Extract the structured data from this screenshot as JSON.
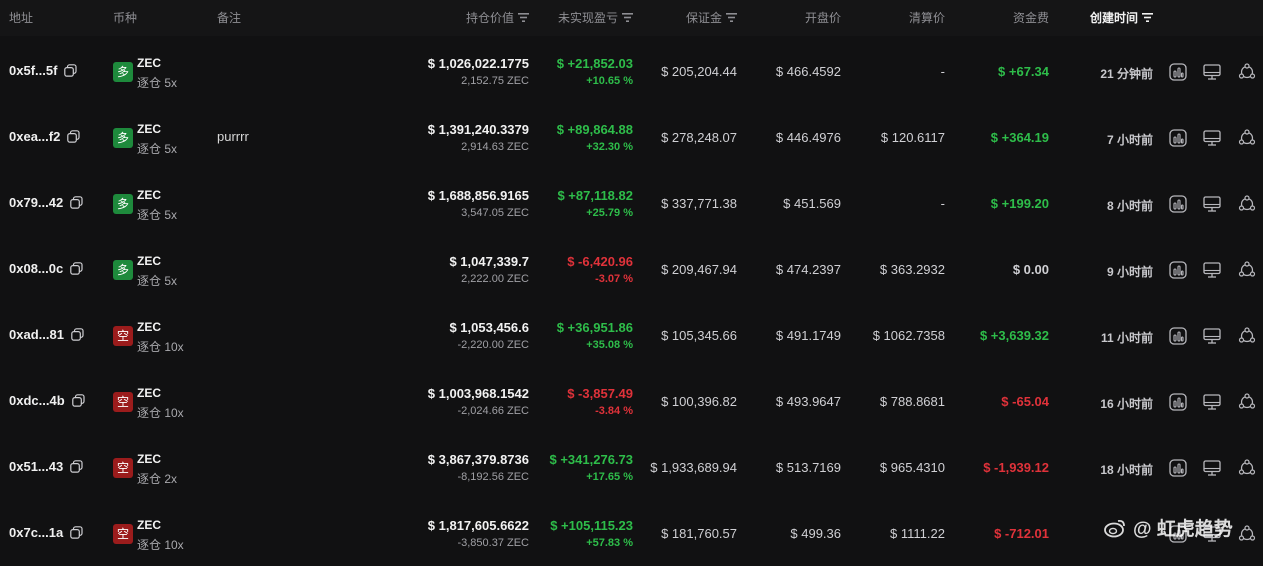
{
  "header": {
    "address": "地址",
    "coin": "币种",
    "note": "备注",
    "value": "持仓价值",
    "pnl": "未实现盈亏",
    "margin": "保证金",
    "open_price": "开盘价",
    "liq_price": "清算价",
    "funding": "资金费",
    "created": "创建时间"
  },
  "rows": [
    {
      "address": "0x5f...5f",
      "side": "多",
      "side_type": "long",
      "coin": "ZEC",
      "mode": "逐仓 5x",
      "note": "",
      "value": "$ 1,026,022.1775",
      "size": "2,152.75 ZEC",
      "pnl": "$ +21,852.03",
      "pnl_pct": "+10.65 %",
      "pnl_sign": "pos",
      "margin": "$ 205,204.44",
      "open": "$ 466.4592",
      "liq": "-",
      "funding": "$ +67.34",
      "funding_sign": "pos",
      "time": "21 分钟前"
    },
    {
      "address": "0xea...f2",
      "side": "多",
      "side_type": "long",
      "coin": "ZEC",
      "mode": "逐仓 5x",
      "note": "purrrr",
      "value": "$ 1,391,240.3379",
      "size": "2,914.63 ZEC",
      "pnl": "$ +89,864.88",
      "pnl_pct": "+32.30 %",
      "pnl_sign": "pos",
      "margin": "$ 278,248.07",
      "open": "$ 446.4976",
      "liq": "$ 120.6117",
      "funding": "$ +364.19",
      "funding_sign": "pos",
      "time": "7 小时前"
    },
    {
      "address": "0x79...42",
      "side": "多",
      "side_type": "long",
      "coin": "ZEC",
      "mode": "逐仓 5x",
      "note": "",
      "value": "$ 1,688,856.9165",
      "size": "3,547.05 ZEC",
      "pnl": "$ +87,118.82",
      "pnl_pct": "+25.79 %",
      "pnl_sign": "pos",
      "margin": "$ 337,771.38",
      "open": "$ 451.569",
      "liq": "-",
      "funding": "$ +199.20",
      "funding_sign": "pos",
      "time": "8 小时前"
    },
    {
      "address": "0x08...0c",
      "side": "多",
      "side_type": "long",
      "coin": "ZEC",
      "mode": "逐仓 5x",
      "note": "",
      "value": "$ 1,047,339.7",
      "size": "2,222.00 ZEC",
      "pnl": "$ -6,420.96",
      "pnl_pct": "-3.07 %",
      "pnl_sign": "neg",
      "margin": "$ 209,467.94",
      "open": "$ 474.2397",
      "liq": "$ 363.2932",
      "funding": "$ 0.00",
      "funding_sign": "neutral",
      "time": "9 小时前"
    },
    {
      "address": "0xad...81",
      "side": "空",
      "side_type": "short",
      "coin": "ZEC",
      "mode": "逐仓 10x",
      "note": "",
      "value": "$ 1,053,456.6",
      "size": "-2,220.00 ZEC",
      "pnl": "$ +36,951.86",
      "pnl_pct": "+35.08 %",
      "pnl_sign": "pos",
      "margin": "$ 105,345.66",
      "open": "$ 491.1749",
      "liq": "$ 1062.7358",
      "funding": "$ +3,639.32",
      "funding_sign": "pos",
      "time": "11 小时前"
    },
    {
      "address": "0xdc...4b",
      "side": "空",
      "side_type": "short",
      "coin": "ZEC",
      "mode": "逐仓 10x",
      "note": "",
      "value": "$ 1,003,968.1542",
      "size": "-2,024.66 ZEC",
      "pnl": "$ -3,857.49",
      "pnl_pct": "-3.84 %",
      "pnl_sign": "neg",
      "margin": "$ 100,396.82",
      "open": "$ 493.9647",
      "liq": "$ 788.8681",
      "funding": "$ -65.04",
      "funding_sign": "neg",
      "time": "16 小时前"
    },
    {
      "address": "0x51...43",
      "side": "空",
      "side_type": "short",
      "coin": "ZEC",
      "mode": "逐仓 2x",
      "note": "",
      "value": "$ 3,867,379.8736",
      "size": "-8,192.56 ZEC",
      "pnl": "$ +341,276.73",
      "pnl_pct": "+17.65 %",
      "pnl_sign": "pos",
      "margin": "$ 1,933,689.94",
      "open": "$ 513.7169",
      "liq": "$ 965.4310",
      "funding": "$ -1,939.12",
      "funding_sign": "neg",
      "time": "18 小时前"
    },
    {
      "address": "0x7c...1a",
      "side": "空",
      "side_type": "short",
      "coin": "ZEC",
      "mode": "逐仓 10x",
      "note": "",
      "value": "$ 1,817,605.6622",
      "size": "-3,850.37 ZEC",
      "pnl": "$ +105,115.23",
      "pnl_pct": "+57.83 %",
      "pnl_sign": "pos",
      "margin": "$ 181,760.57",
      "open": "$ 499.36",
      "liq": "$ 1111.22",
      "funding": "$ -712.01",
      "funding_sign": "neg",
      "time": ""
    }
  ],
  "watermark": "@ 虹虎趋势",
  "colors": {
    "positive": "#2ebd4a",
    "negative": "#e0323a",
    "long_badge": "#1e8a3c",
    "short_badge": "#9b1c1c",
    "background": "#111112"
  },
  "row_icons": [
    "chart-icon",
    "monitor-icon",
    "share-icon"
  ]
}
